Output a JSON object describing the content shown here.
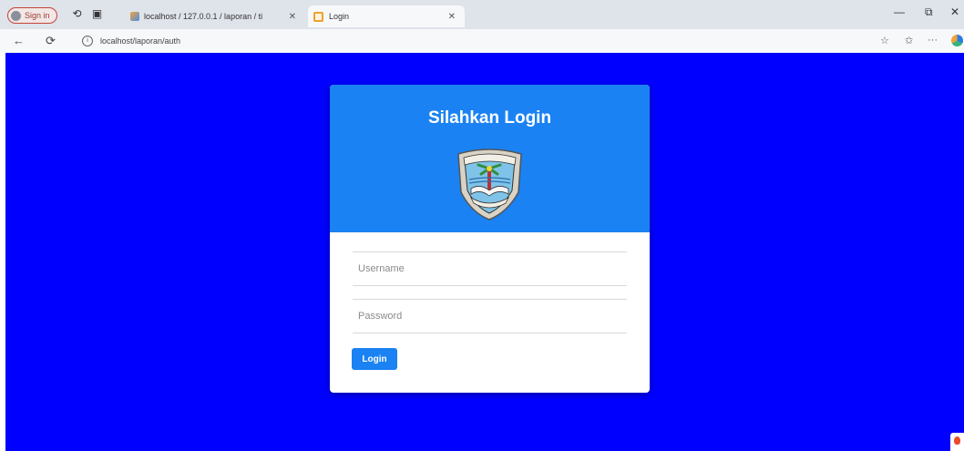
{
  "browser": {
    "signin_label": "Sign in",
    "tabs": [
      {
        "title": "localhost / 127.0.0.1 / laporan / ti"
      },
      {
        "title": "Login"
      }
    ],
    "url": "localhost/laporan/auth"
  },
  "login": {
    "title": "Silahkan Login",
    "username_placeholder": "Username",
    "password_placeholder": "Password",
    "button_label": "Login"
  },
  "colors": {
    "page_background": "#0000ff",
    "card_header": "#1a82f2",
    "button": "#1a82f2"
  },
  "icons": [
    "back-arrow-icon",
    "refresh-icon",
    "info-icon",
    "star-icon",
    "favorites-icon",
    "more-icon",
    "close-icon",
    "minimize-icon",
    "maximize-icon",
    "school-emblem"
  ]
}
